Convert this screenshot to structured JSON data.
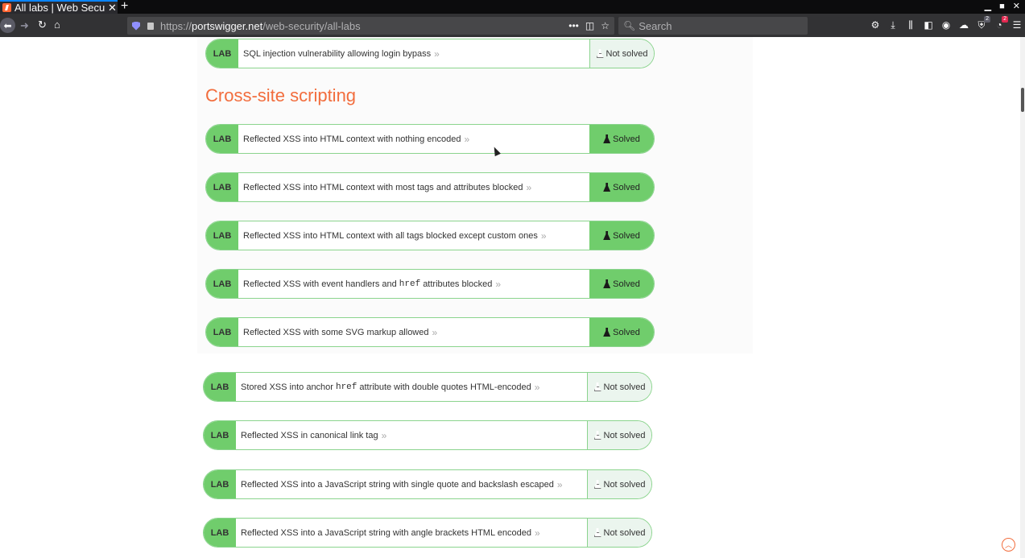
{
  "browser": {
    "tab_title": "All labs | Web Security Academy",
    "new_tab_label": "+",
    "url_prefix": "https://",
    "url_host": "portswigger.net",
    "url_path": "/web-security/all-labs",
    "search_placeholder": "Search",
    "toolbar_badges": {
      "extension_badge": "2",
      "profile_badge": "2"
    }
  },
  "page": {
    "section_title": "Cross-site scripting",
    "accent_color": "#f26d3d",
    "lab_tag": "LAB",
    "status_solved": "Solved",
    "status_not_solved": "Not solved",
    "labs": [
      {
        "title": "SQL injection vulnerability allowing login bypass",
        "status": "Not solved"
      },
      {
        "title": "Reflected XSS into HTML context with nothing encoded",
        "status": "Solved"
      },
      {
        "title": "Reflected XSS into HTML context with most tags and attributes blocked",
        "status": "Solved"
      },
      {
        "title": "Reflected XSS into HTML context with all tags blocked except custom ones",
        "status": "Solved"
      },
      {
        "title_before": "Reflected XSS with event handlers and",
        "code": "href",
        "title_after": "attributes blocked",
        "status": "Solved"
      },
      {
        "title": "Reflected XSS with some SVG markup allowed",
        "status": "Solved"
      },
      {
        "title_before": "Stored XSS into anchor",
        "code": "href",
        "title_after": "attribute with double quotes HTML-encoded",
        "status": "Not solved"
      },
      {
        "title": "Reflected XSS in canonical link tag",
        "status": "Not solved"
      },
      {
        "title": "Reflected XSS into a JavaScript string with single quote and backslash escaped",
        "status": "Not solved"
      },
      {
        "title": "Reflected XSS into a JavaScript string with angle brackets HTML encoded",
        "status": "Not solved"
      }
    ]
  }
}
